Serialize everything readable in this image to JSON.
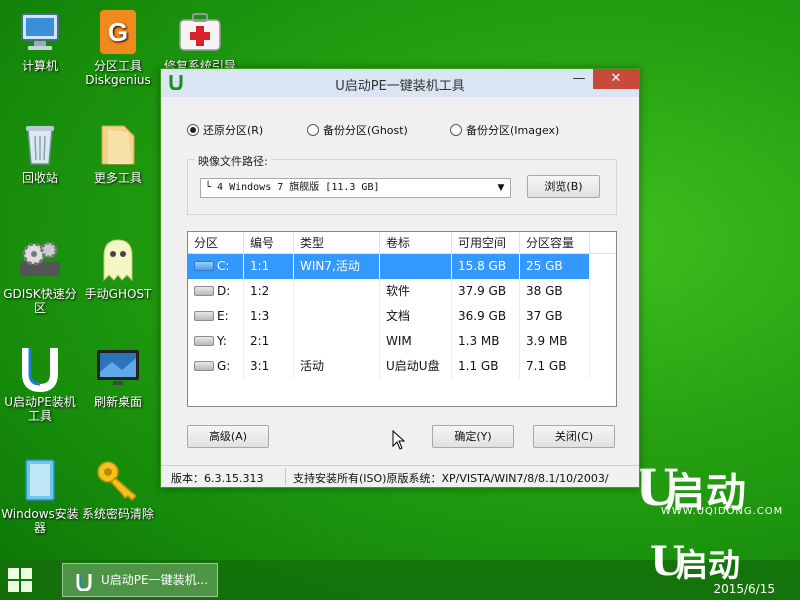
{
  "desktop": {
    "icons": [
      {
        "label": "计算机"
      },
      {
        "label": "分区工具\nDiskgenius"
      },
      {
        "label": "修复系统引导"
      },
      {
        "label": "回收站"
      },
      {
        "label": "更多工具"
      },
      {
        "label": "GDISK快速分区"
      },
      {
        "label": "手动GHOST"
      },
      {
        "label": "U启动PE装机工具"
      },
      {
        "label": "刷新桌面"
      },
      {
        "label": "Windows安装器"
      },
      {
        "label": "系统密码清除"
      }
    ]
  },
  "window": {
    "title": "U启动PE一键装机工具",
    "minimize": "—",
    "close": "✕",
    "modes": [
      {
        "label": "还原分区(R)",
        "checked": true
      },
      {
        "label": "备份分区(Ghost)",
        "checked": false
      },
      {
        "label": "备份分区(Imagex)",
        "checked": false
      }
    ],
    "image_path_label": "映像文件路径:",
    "image_path_value": "└ 4 Windows 7 旗舰版 [11.3 GB]",
    "browse_button": "浏览(B)",
    "table": {
      "columns": [
        "分区",
        "编号",
        "类型",
        "卷标",
        "可用空间",
        "分区容量"
      ],
      "rows": [
        {
          "drive": "C:",
          "num": "1:1",
          "type": "WIN7,活动",
          "label": "",
          "free": "15.8 GB",
          "size": "25 GB",
          "selected": true
        },
        {
          "drive": "D:",
          "num": "1:2",
          "type": "",
          "label": "软件",
          "free": "37.9 GB",
          "size": "38 GB",
          "selected": false
        },
        {
          "drive": "E:",
          "num": "1:3",
          "type": "",
          "label": "文档",
          "free": "36.9 GB",
          "size": "37 GB",
          "selected": false
        },
        {
          "drive": "Y:",
          "num": "2:1",
          "type": "",
          "label": "WIM",
          "free": "1.3 MB",
          "size": "3.9 MB",
          "selected": false
        },
        {
          "drive": "G:",
          "num": "3:1",
          "type": "活动",
          "label": "U启动U盘",
          "free": "1.1 GB",
          "size": "7.1 GB",
          "selected": false
        }
      ]
    },
    "advanced_button": "高级(A)",
    "ok_button": "确定(Y)",
    "close_button": "关闭(C)",
    "status_version": "版本：6.3.15.313",
    "status_support": "支持安装所有(ISO)原版系统：XP/VISTA/WIN7/8/8.1/10/2003/"
  },
  "branding": {
    "logo_text": "启动",
    "logo_url": "WWW.UQIDONG.COM"
  },
  "taskbar": {
    "task_label": "U启动PE一键装机...",
    "date": "2015/6/15"
  },
  "colors": {
    "accent": "#3399ff",
    "desktop": "#26a012",
    "close": "#c74a3b"
  }
}
